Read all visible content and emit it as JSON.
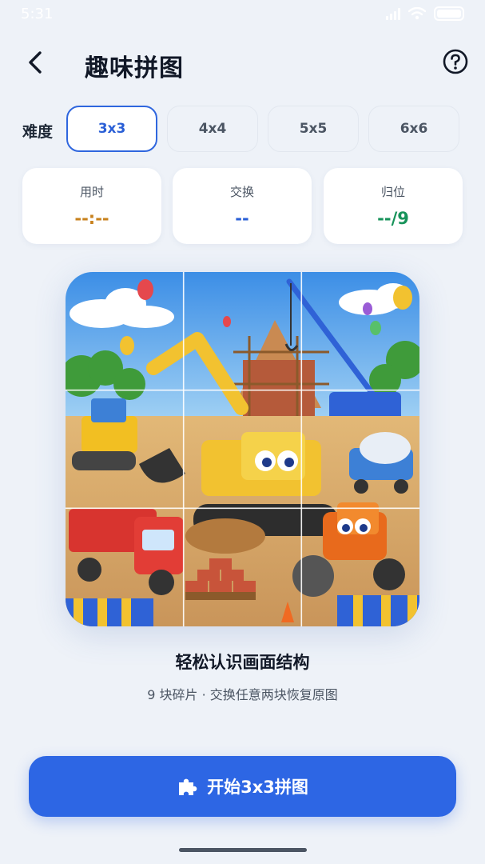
{
  "status_bar": {
    "time": "5:31"
  },
  "header": {
    "title": "趣味拼图",
    "back_icon": "chevron-left-icon",
    "help_icon": "question-circle-icon"
  },
  "difficulty": {
    "label": "难度",
    "selected": "3x3",
    "options": [
      "3x3",
      "4x4",
      "5x5",
      "6x6"
    ]
  },
  "stats": [
    {
      "label": "用时",
      "value": "--:--",
      "color": "#c8811d"
    },
    {
      "label": "交换",
      "value": "--",
      "color": "#2a5fd6"
    },
    {
      "label": "归位",
      "value": "--/9",
      "color": "#17935a"
    }
  ],
  "puzzle": {
    "grid": 3,
    "image": "construction-site-cartoon"
  },
  "caption": "轻松认识画面结构",
  "subcaption": "9 块碎片 · 交换任意两块恢复原图",
  "start_button": {
    "label": "开始3x3拼图",
    "icon": "puzzle-piece-icon"
  },
  "colors": {
    "accent": "#2d66e4",
    "background": "#eef2f8"
  }
}
